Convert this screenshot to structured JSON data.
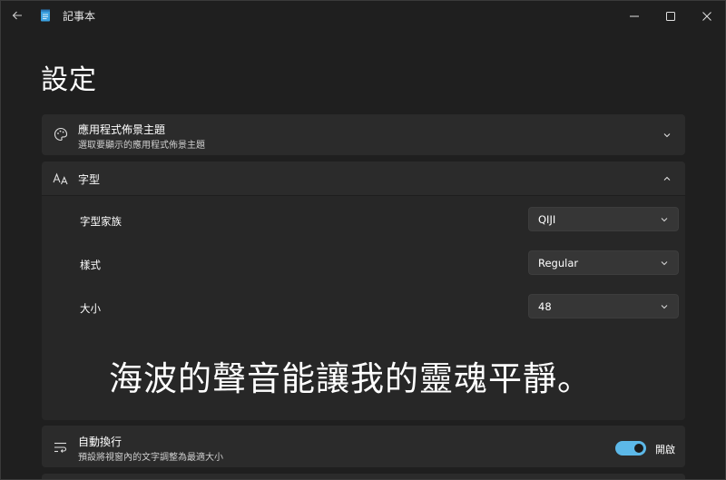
{
  "window": {
    "title": "記事本"
  },
  "page": {
    "title": "設定"
  },
  "theme_card": {
    "title": "應用程式佈景主題",
    "subtitle": "選取要顯示的應用程式佈景主題"
  },
  "font_card": {
    "title": "字型",
    "rows": [
      {
        "label": "字型家族",
        "value": "QIJI"
      },
      {
        "label": "樣式",
        "value": "Regular"
      },
      {
        "label": "大小",
        "value": "48"
      }
    ],
    "preview_text": "海波的聲音能讓我的靈魂平靜。"
  },
  "wrap_card": {
    "title": "自動換行",
    "subtitle": "預設將視窗內的文字調整為最適大小",
    "toggle_label": "開啟",
    "toggle_on": true
  },
  "colors": {
    "accent": "#5cb8e8",
    "background": "#1f1f1f",
    "card": "#2b2b2b"
  },
  "icons": {
    "back": "back-arrow-icon",
    "app": "notepad-icon",
    "minimize": "minimize-icon",
    "maximize": "maximize-icon",
    "close": "close-icon",
    "theme": "palette-icon",
    "font": "font-icon",
    "wrap": "word-wrap-icon",
    "expand": "chevron-down-icon",
    "collapse": "chevron-up-icon"
  }
}
